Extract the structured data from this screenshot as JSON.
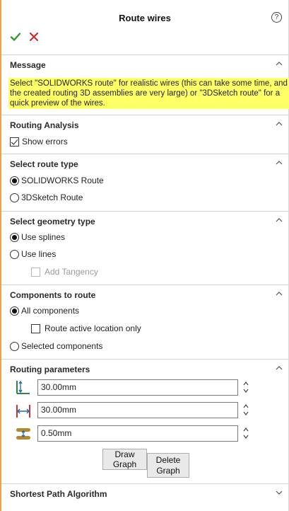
{
  "panel": {
    "title": "Route wires",
    "help_glyph": "?",
    "accent_color": "#f0a050"
  },
  "actions": {
    "ok": "check-icon",
    "cancel": "x-icon"
  },
  "message": {
    "header": "Message",
    "text": "Select \"SOLIDWORKS route\" for realistic wires (this can take some time, and the created routing 3D assemblies are very large) or \"3DSketch route\" for a quick preview of the wires.",
    "highlight_color": "#ffff66"
  },
  "routing_analysis": {
    "header": "Routing Analysis",
    "show_errors": {
      "label": "Show errors",
      "checked": true
    }
  },
  "route_type": {
    "header": "Select route type",
    "options": [
      {
        "label": "SOLIDWORKS Route",
        "selected": true
      },
      {
        "label": "3DSketch Route",
        "selected": false
      }
    ]
  },
  "geometry_type": {
    "header": "Select geometry type",
    "options": [
      {
        "label": "Use splines",
        "selected": true
      },
      {
        "label": "Use lines",
        "selected": false
      }
    ],
    "add_tangency": {
      "label": "Add Tangency",
      "checked": false,
      "enabled": false
    }
  },
  "components": {
    "header": "Components to route",
    "all": {
      "label": "All components",
      "selected": true
    },
    "route_active_only": {
      "label": "Route active location only",
      "checked": false
    },
    "selected": {
      "label": "Selected components",
      "selected": false
    }
  },
  "routing_parameters": {
    "header": "Routing parameters",
    "fields": [
      {
        "icon": "vertical-distance-icon",
        "value": "30.00mm"
      },
      {
        "icon": "horizontal-distance-icon",
        "value": "30.00mm"
      },
      {
        "icon": "wire-diameter-icon",
        "value": "0.50mm"
      }
    ],
    "draw_graph": "Draw Graph",
    "delete_graph_line1": "Delete",
    "delete_graph_line2": "Graph"
  },
  "shortest_path": {
    "header": "Shortest Path Algorithm"
  }
}
